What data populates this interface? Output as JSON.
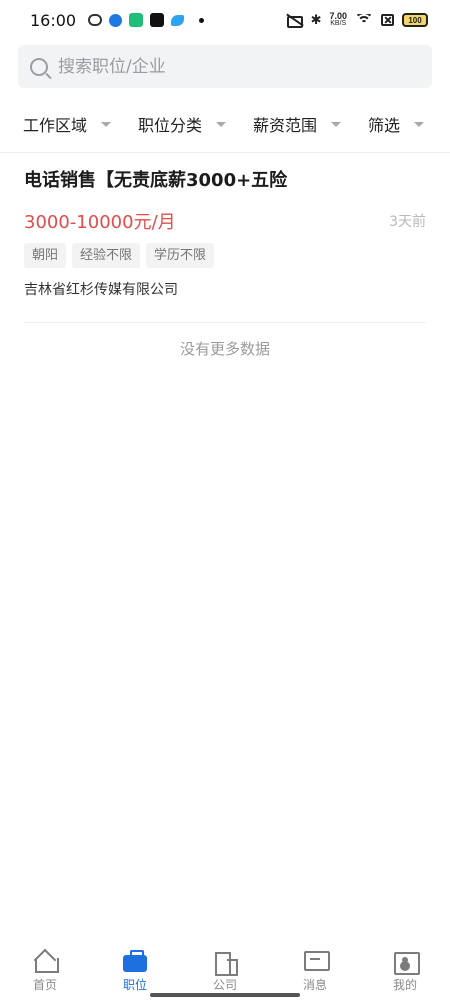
{
  "status_bar": {
    "time": "16:00",
    "net_speed_value": "7.00",
    "net_speed_unit": "KB/S",
    "battery": "100"
  },
  "search": {
    "placeholder": "搜索职位/企业"
  },
  "filters": [
    {
      "label": "工作区域"
    },
    {
      "label": "职位分类"
    },
    {
      "label": "薪资范围"
    },
    {
      "label": "筛选"
    }
  ],
  "job": {
    "title": "电话销售【无责底薪3000+五险",
    "salary": "3000-10000元/月",
    "posted": "3天前",
    "tags": [
      "朝阳",
      "经验不限",
      "学历不限"
    ],
    "company": "吉林省红杉传媒有限公司"
  },
  "list_footer": "没有更多数据",
  "tabs": [
    {
      "label": "首页",
      "icon": "home-icon",
      "active": false
    },
    {
      "label": "职位",
      "icon": "briefcase-icon",
      "active": true
    },
    {
      "label": "公司",
      "icon": "building-icon",
      "active": false
    },
    {
      "label": "消息",
      "icon": "message-icon",
      "active": false
    },
    {
      "label": "我的",
      "icon": "profile-icon",
      "active": false
    }
  ],
  "colors": {
    "accent": "#1e6fe0",
    "salary": "#e24c4c"
  }
}
